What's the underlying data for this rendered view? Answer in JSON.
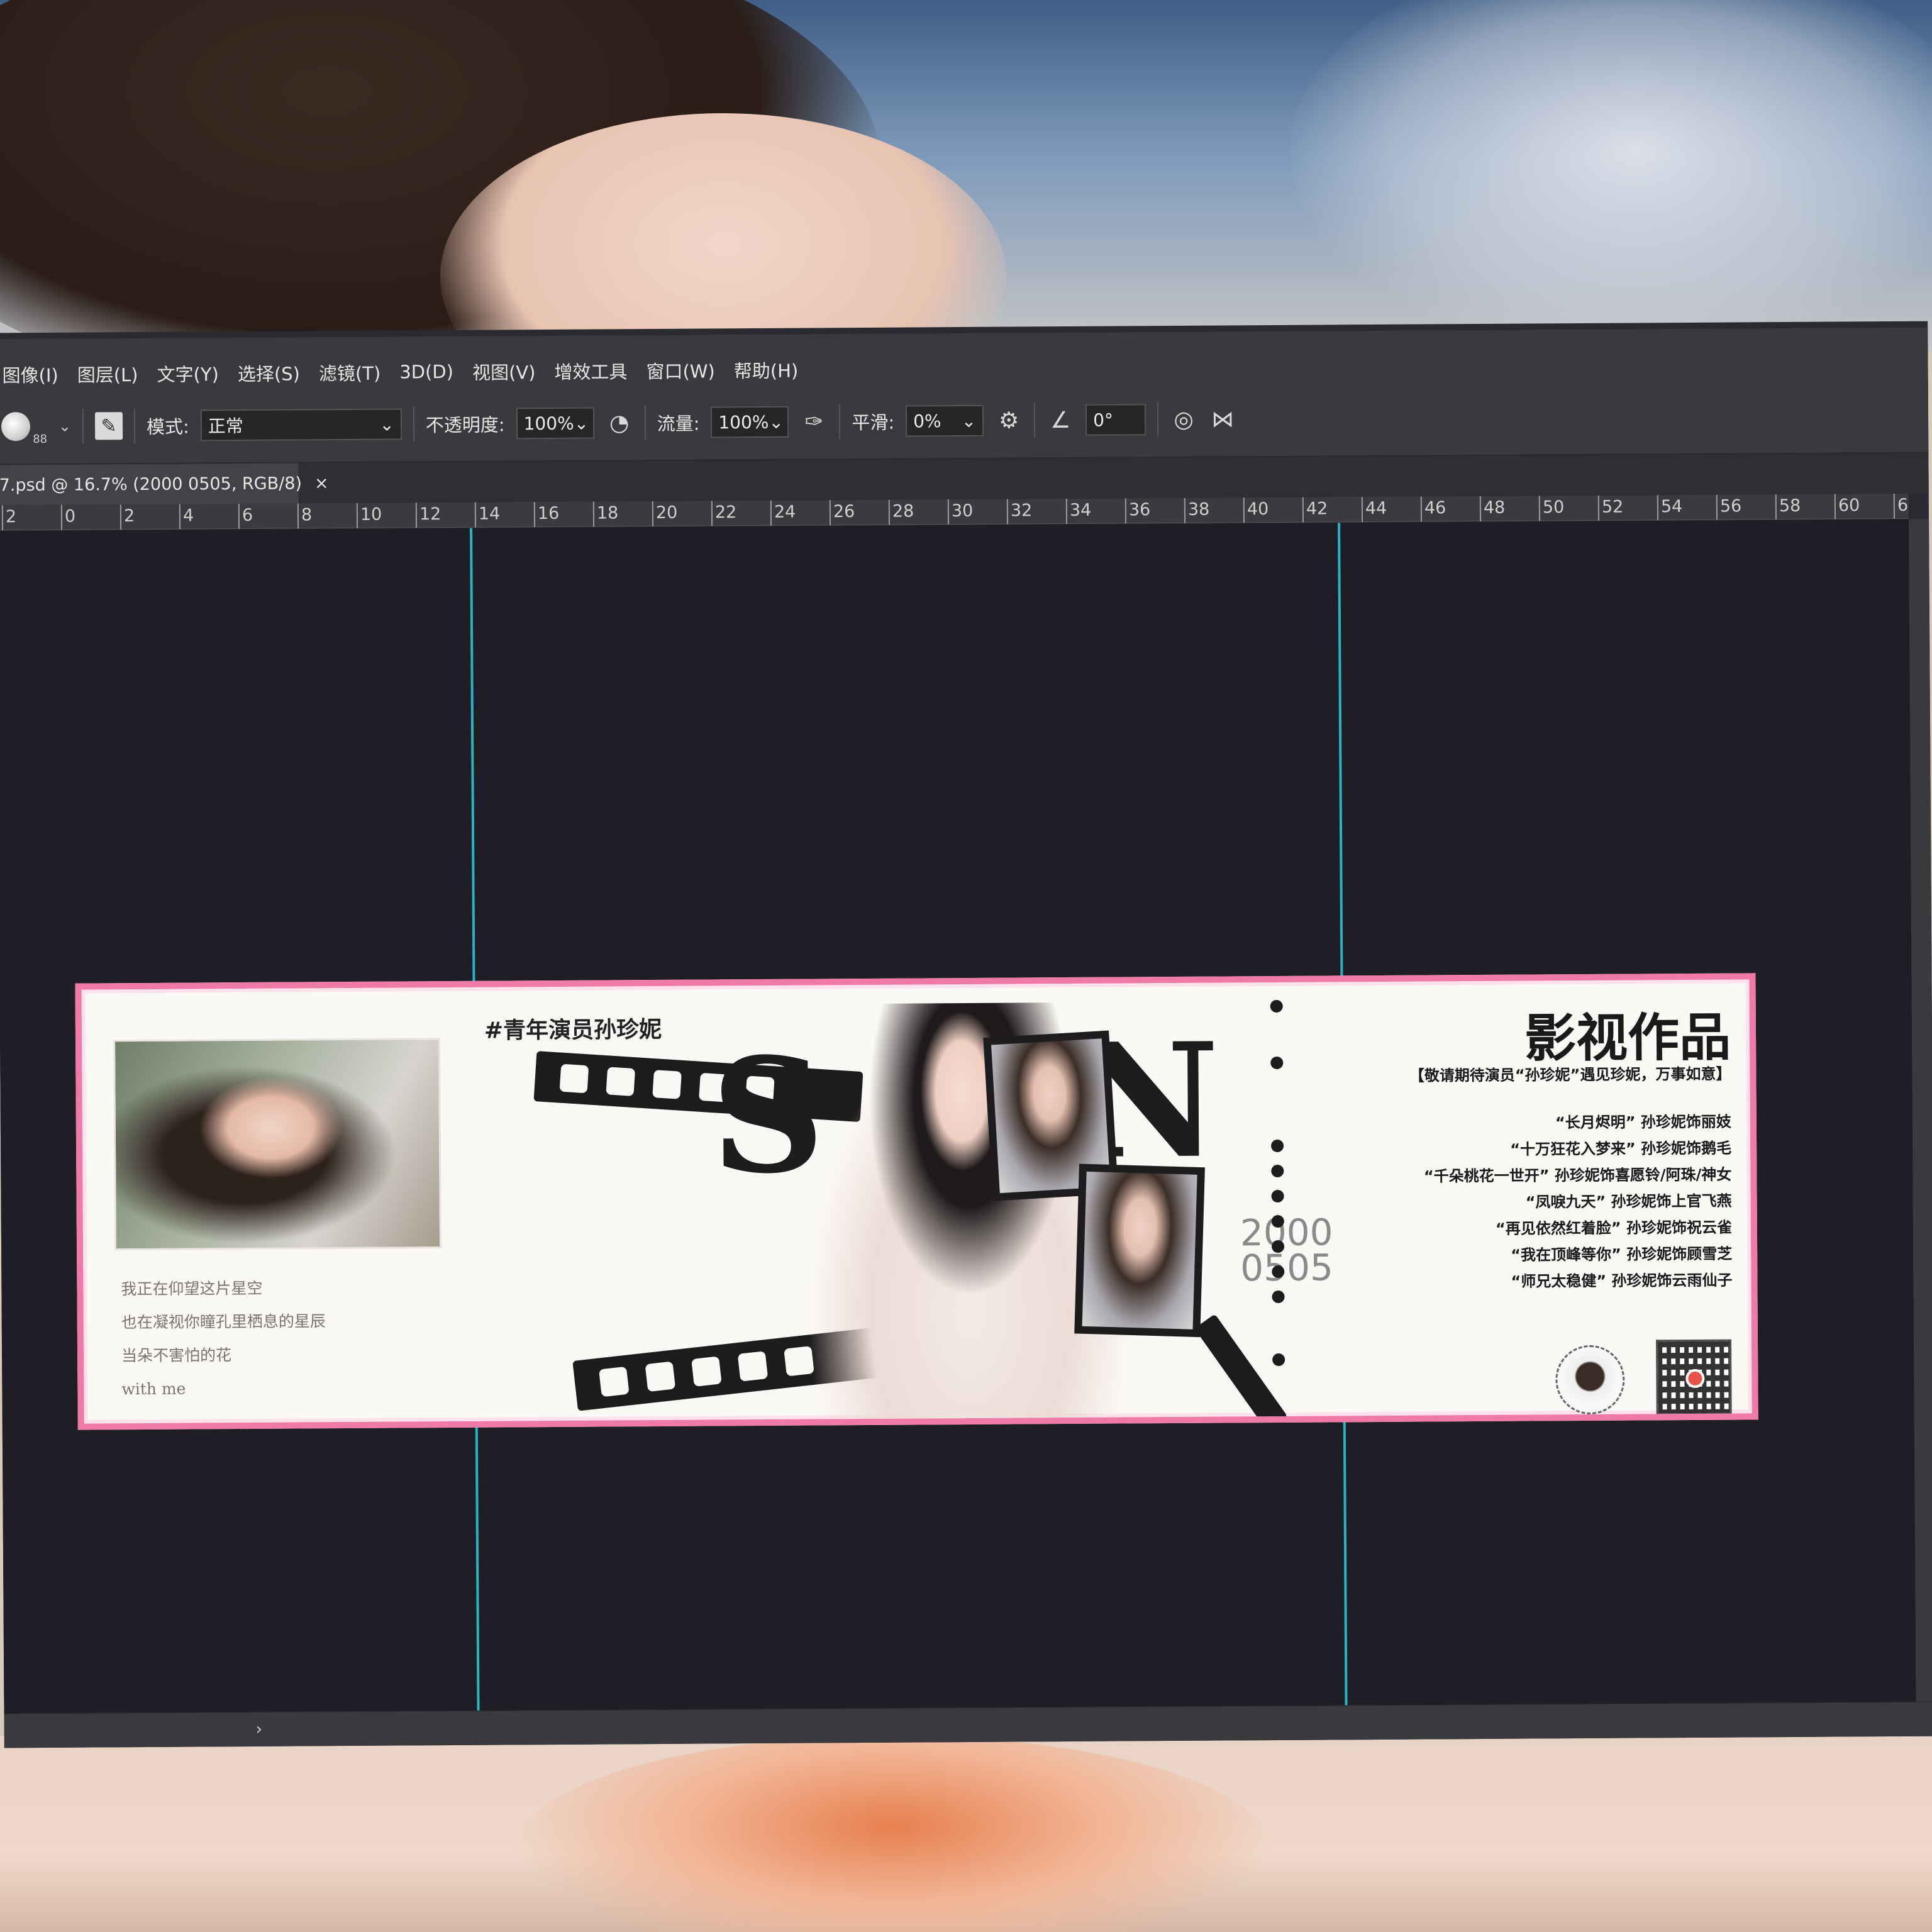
{
  "menu": [
    "图像(I)",
    "图层(L)",
    "文字(Y)",
    "选择(S)",
    "滤镜(T)",
    "3D(D)",
    "视图(V)",
    "增效工具",
    "窗口(W)",
    "帮助(H)"
  ],
  "options": {
    "brush_size": "88",
    "mode_label": "模式:",
    "mode_value": "正常",
    "opacity_label": "不透明度:",
    "opacity_value": "100%",
    "flow_label": "流量:",
    "flow_value": "100%",
    "smoothing_label": "平滑:",
    "smoothing_value": "0%",
    "angle_value": "0°"
  },
  "document_tab": {
    "title": "7.psd @ 16.7% (2000 0505, RGB/8)",
    "close": "×"
  },
  "ruler_labels": [
    "2",
    "0",
    "2",
    "4",
    "6",
    "8",
    "10",
    "12",
    "14",
    "16",
    "18",
    "20",
    "22",
    "24",
    "26",
    "28",
    "30",
    "32",
    "34",
    "36",
    "38",
    "40",
    "42",
    "44",
    "46",
    "48",
    "50",
    "52",
    "54",
    "56",
    "58",
    "60",
    "6"
  ],
  "ticket": {
    "poem": [
      "我正在仰望这片星空",
      "也在凝视你瞳孔里栖息的星辰",
      "当朵不害怕的花",
      "with me"
    ],
    "hashtag": "#青年演员孙珍妮",
    "date": [
      "2000",
      "0505"
    ],
    "works_title": "影视作品",
    "works_subtitle": "【敬请期待演员“孙珍妮”遇见珍妮，万事如意】",
    "works": [
      "“长月烬明” 孙珍妮饰丽妓",
      "“十万狂花入梦来” 孙珍妮饰鹅毛",
      "“千朵桃花一世开” 孙珍妮饰喜愿铃/阿珠/神女",
      "“凤唳九天” 孙珍妮饰上官飞燕",
      "“再见依然红着脸” 孙珍妮饰祝云雀",
      "“我在顶峰等你” 孙珍妮饰顾雪芝",
      "“师兄太稳健” 孙珍妮饰云雨仙子"
    ]
  },
  "status": {
    "arrow": "›"
  },
  "colors": {
    "guide": "#27b4c4",
    "ticket_border": "#f07aa7",
    "qr_logo": "#e4362a"
  }
}
